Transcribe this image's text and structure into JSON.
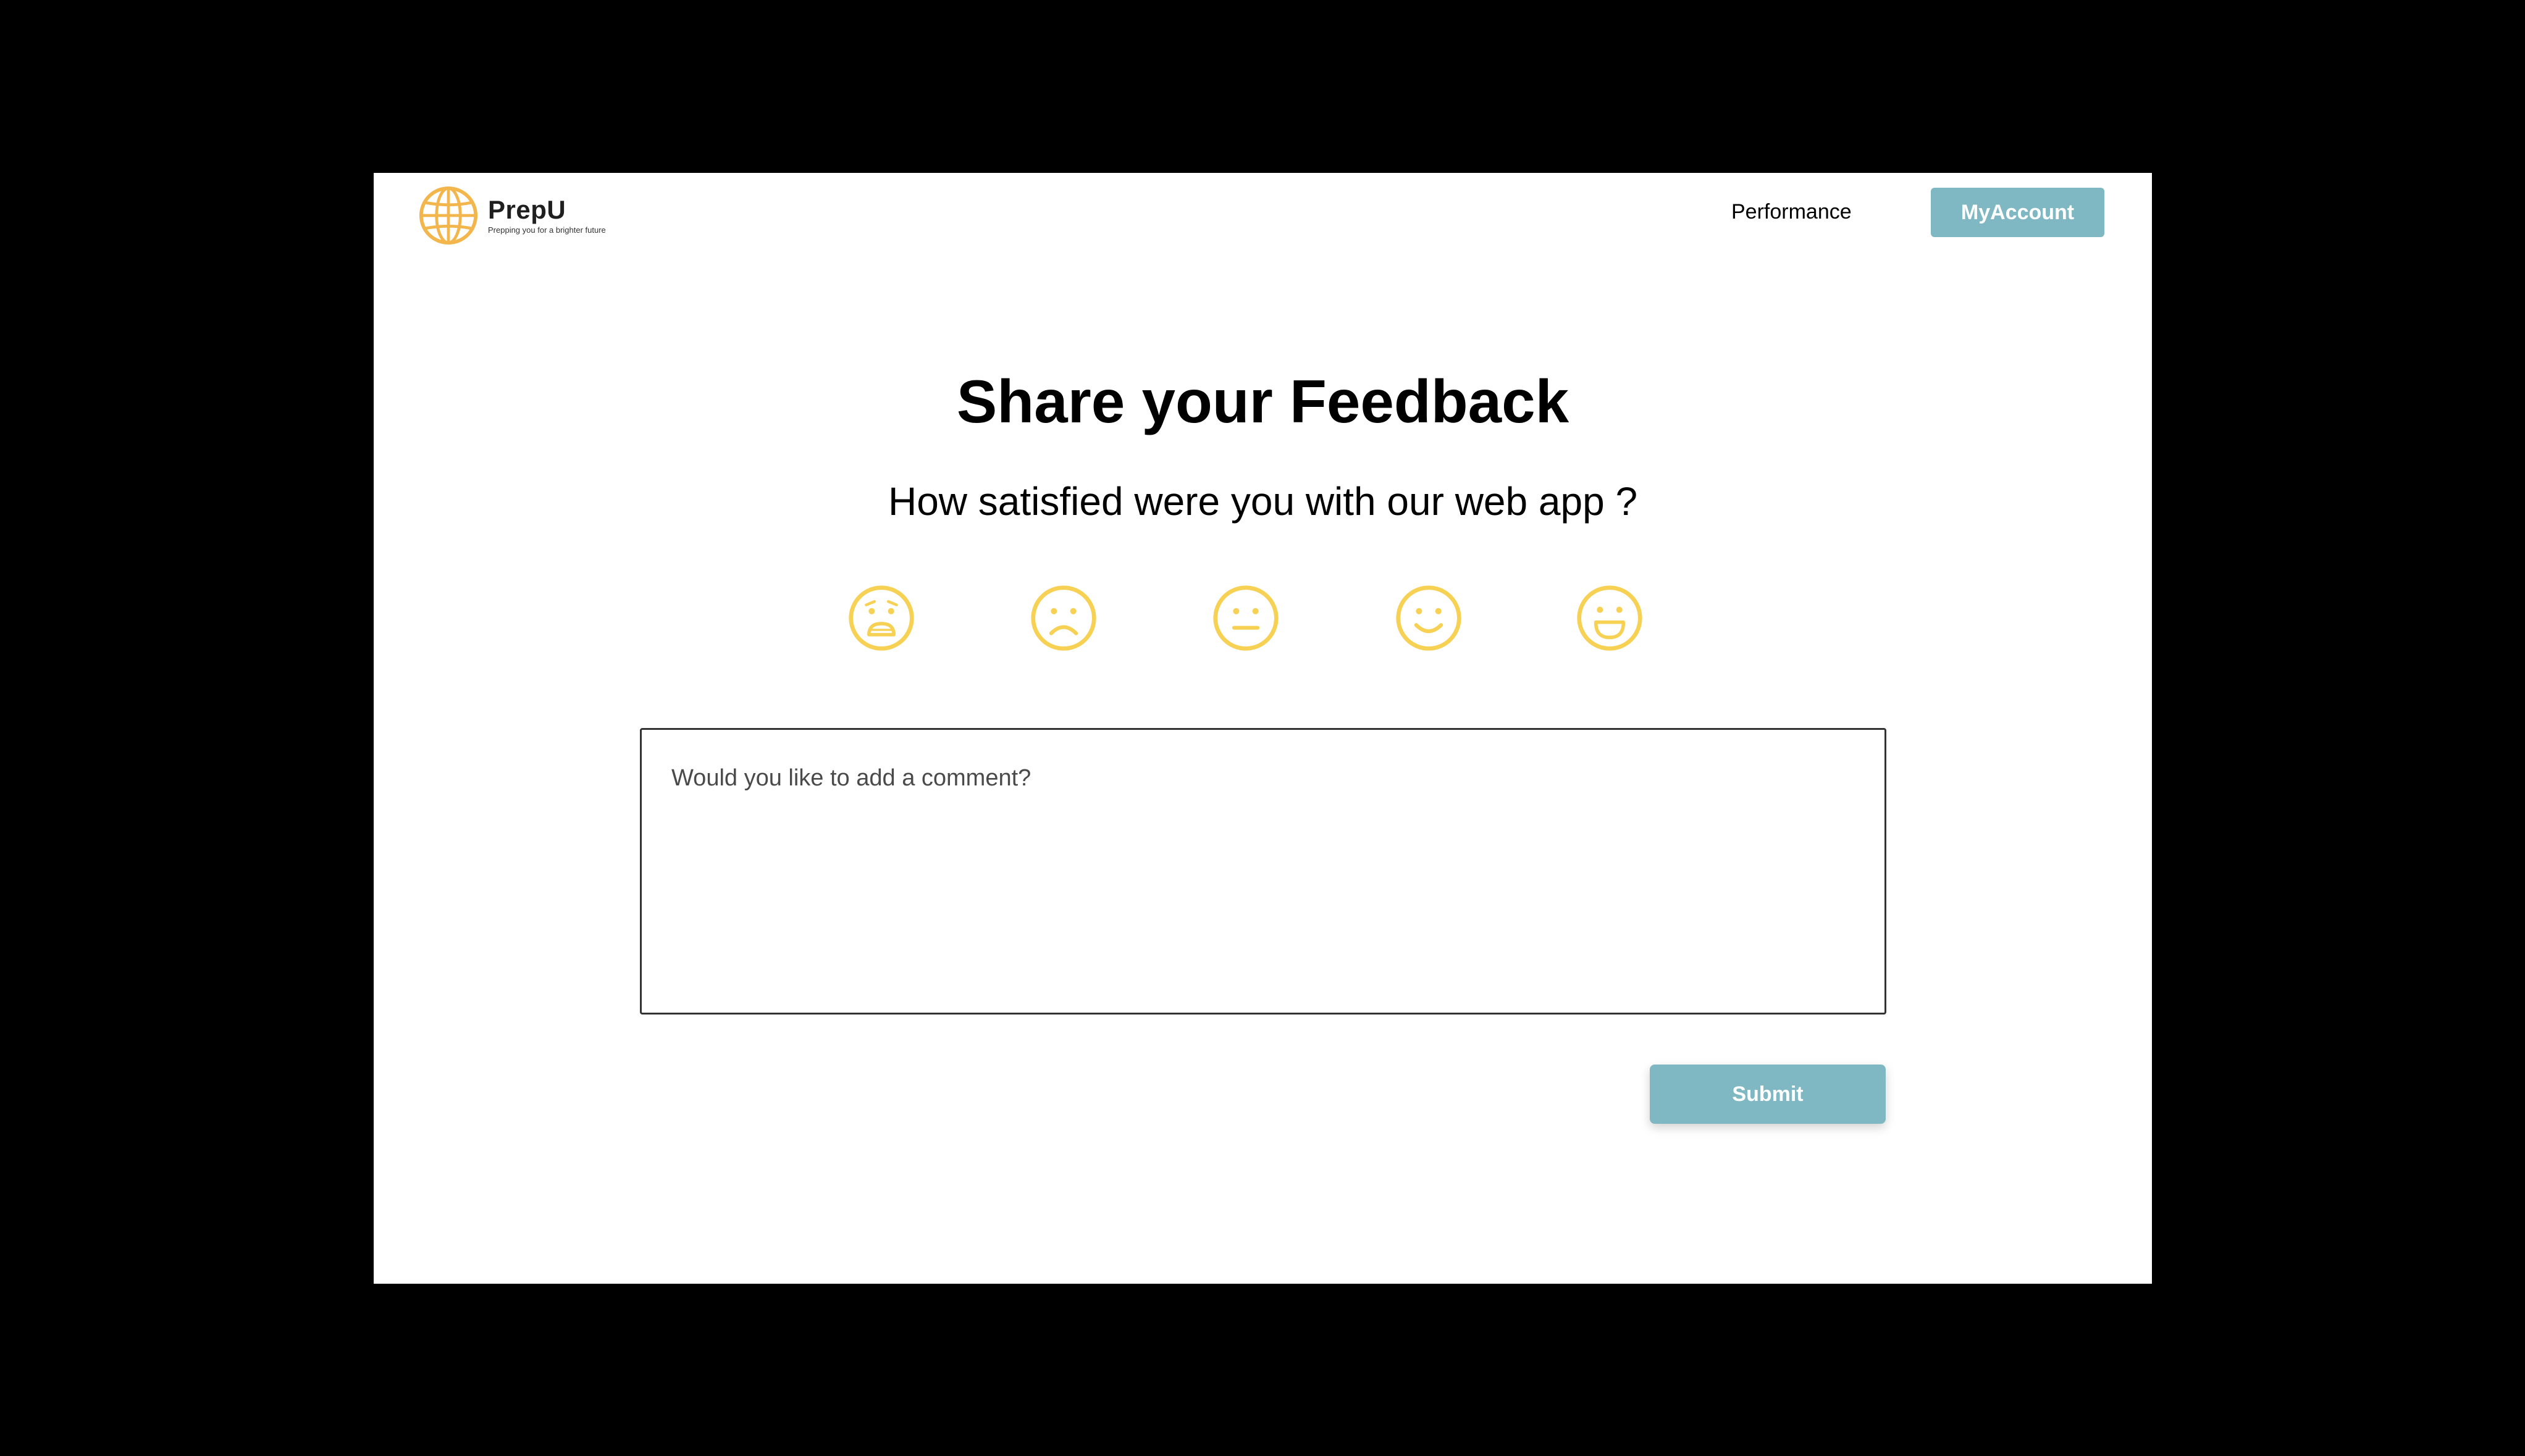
{
  "app": {
    "name": "PrepU",
    "tagline": "Prepping you for a brighter future",
    "logo_icon": "globe-icon"
  },
  "nav": {
    "performance_label": "Performance",
    "myaccount_label": "MyAccount"
  },
  "feedback": {
    "title": "Share your Feedback",
    "question": "How satisfied were you with our web app ?",
    "ratings": [
      {
        "icon": "anguished-face-icon"
      },
      {
        "icon": "frowning-face-icon"
      },
      {
        "icon": "neutral-face-icon"
      },
      {
        "icon": "smiling-face-icon"
      },
      {
        "icon": "grinning-face-icon"
      }
    ],
    "comment": {
      "placeholder": "Would you like to add a comment?",
      "value": ""
    },
    "submit_label": "Submit"
  },
  "colors": {
    "accent": "#7fb8c2",
    "rating_yellow": "#f7d154",
    "logo_orange": "#f3b64c",
    "backdrop": "#000000",
    "surface": "#ffffff"
  }
}
